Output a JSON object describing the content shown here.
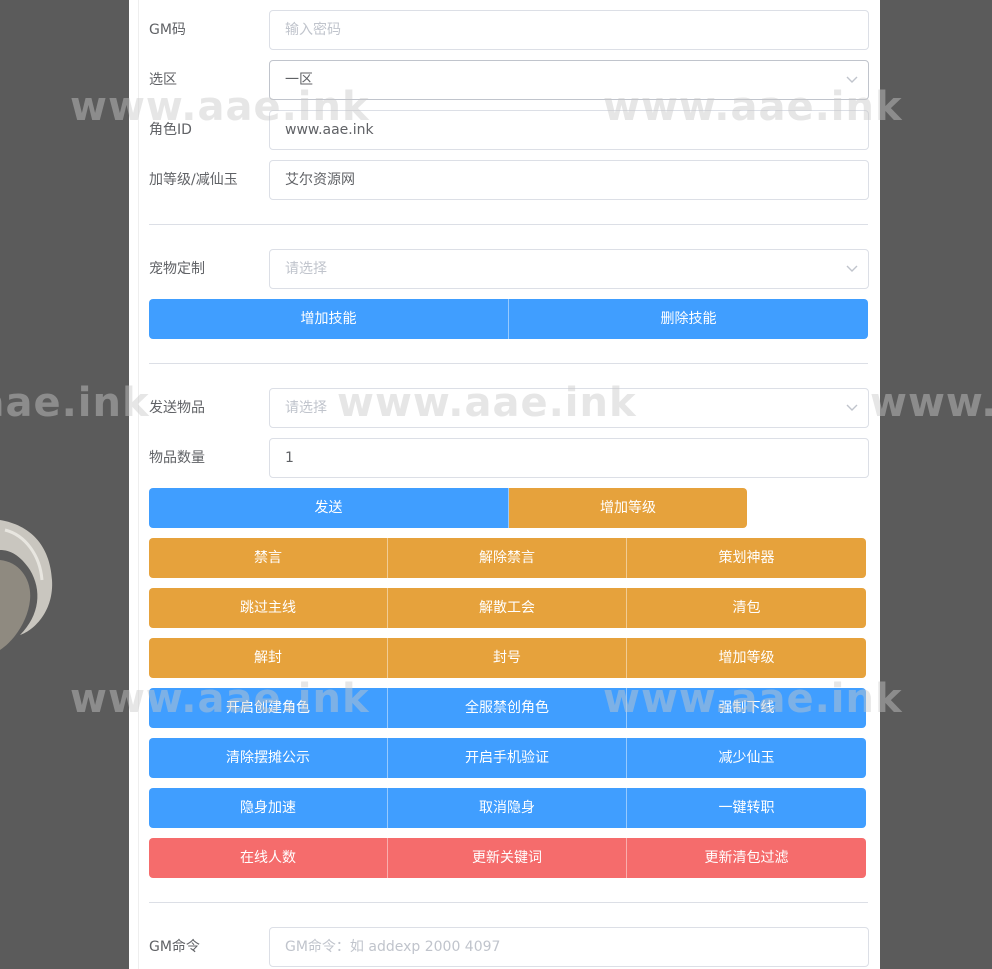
{
  "form": {
    "gm_code": {
      "label": "GM码",
      "placeholder": "输入密码"
    },
    "zone": {
      "label": "选区",
      "value": "一区"
    },
    "role_id": {
      "label": "角色ID",
      "value": "www.aae.ink"
    },
    "level_jade": {
      "label": "加等级/减仙玉",
      "value": "艾尔资源网"
    },
    "pet": {
      "label": "宠物定制",
      "placeholder": "请选择"
    },
    "send_item": {
      "label": "发送物品",
      "placeholder": "请选择"
    },
    "item_qty": {
      "label": "物品数量",
      "value": "1"
    },
    "gm_command": {
      "label": "GM命令",
      "placeholder": "GM命令：如 addexp 2000 4097"
    }
  },
  "buttons": {
    "add_skill": "增加技能",
    "delete_skill": "删除技能",
    "send": "发送",
    "add_level": "增加等级",
    "row1": [
      "禁言",
      "解除禁言",
      "策划神器"
    ],
    "row2": [
      "跳过主线",
      "解散工会",
      "清包"
    ],
    "row3": [
      "解封",
      "封号",
      "增加等级"
    ],
    "row4": [
      "开启创建角色",
      "全服禁创角色",
      "强制下线"
    ],
    "row5": [
      "清除摆摊公示",
      "开启手机验证",
      "减少仙玉"
    ],
    "row6": [
      "隐身加速",
      "取消隐身",
      "一键转职"
    ],
    "row7": [
      "在线人数",
      "更新关键词",
      "更新清包过滤"
    ]
  },
  "watermark": "www.aae.ink",
  "colors": {
    "primary": "#409eff",
    "warning": "#e6a23c",
    "danger": "#f56c6c",
    "border": "#dcdfe6",
    "background": "#5b5b5b"
  },
  "icons": {
    "select_arrow": "chevron-down-icon"
  }
}
